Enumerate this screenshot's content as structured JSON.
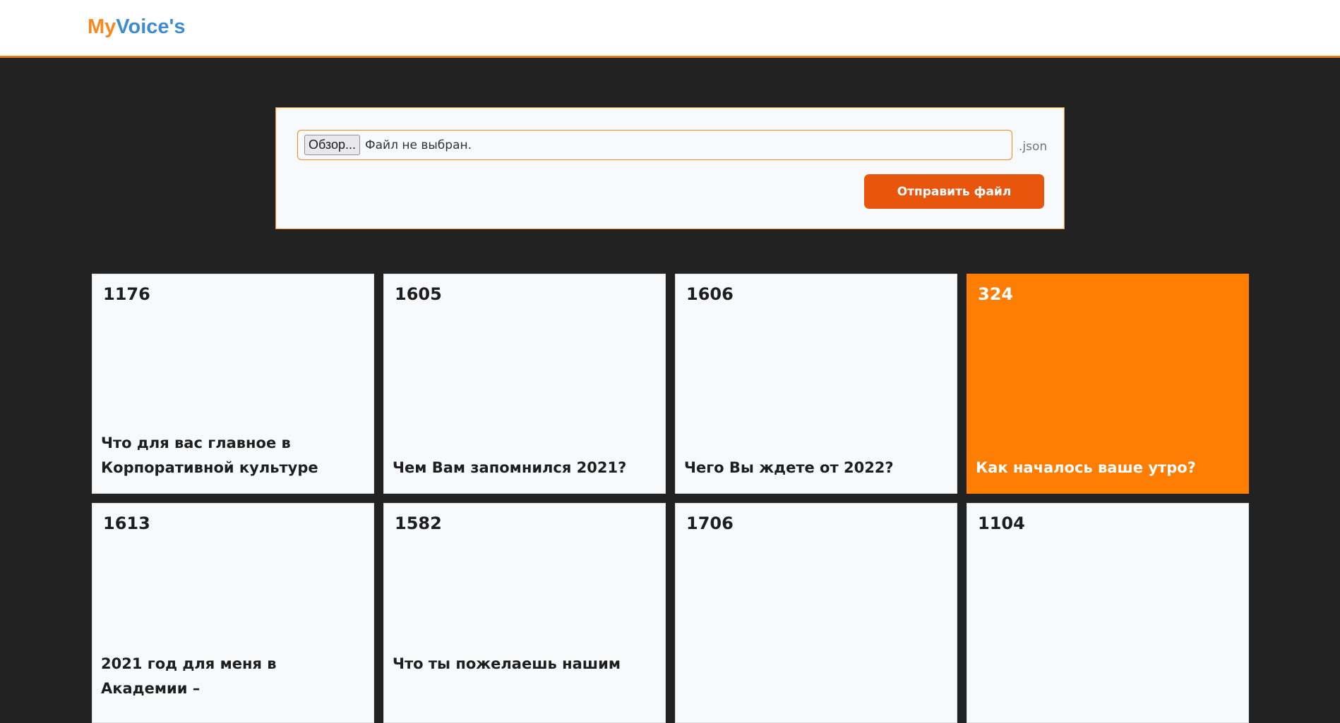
{
  "header": {
    "logo_part1": "My",
    "logo_part2": "Voice's",
    "accent_color": "#e8781e"
  },
  "upload": {
    "browse_label": "Обзор...",
    "file_status": "Файл не выбран.",
    "extension_hint": ".json",
    "submit_label": "Отправить файл"
  },
  "cards": [
    {
      "id": "1176",
      "title": "Что для вас главное в Корпоративной культуре",
      "highlighted": false
    },
    {
      "id": "1605",
      "title": "Чем Вам запомнился 2021?",
      "highlighted": false
    },
    {
      "id": "1606",
      "title": "Чего Вы ждете от 2022?",
      "highlighted": false
    },
    {
      "id": "324",
      "title": "Как началось ваше утро?",
      "highlighted": true
    },
    {
      "id": "1613",
      "title": "2021 год для меня в Академии –",
      "highlighted": false
    },
    {
      "id": "1582",
      "title": "Что ты пожелаешь нашим",
      "highlighted": false
    },
    {
      "id": "1706",
      "title": "",
      "highlighted": false
    },
    {
      "id": "1104",
      "title": "",
      "highlighted": false
    }
  ],
  "colors": {
    "background": "#222222",
    "card": "#f8f9fa",
    "card_highlight": "#fd7e03",
    "button": "#e8560e"
  }
}
